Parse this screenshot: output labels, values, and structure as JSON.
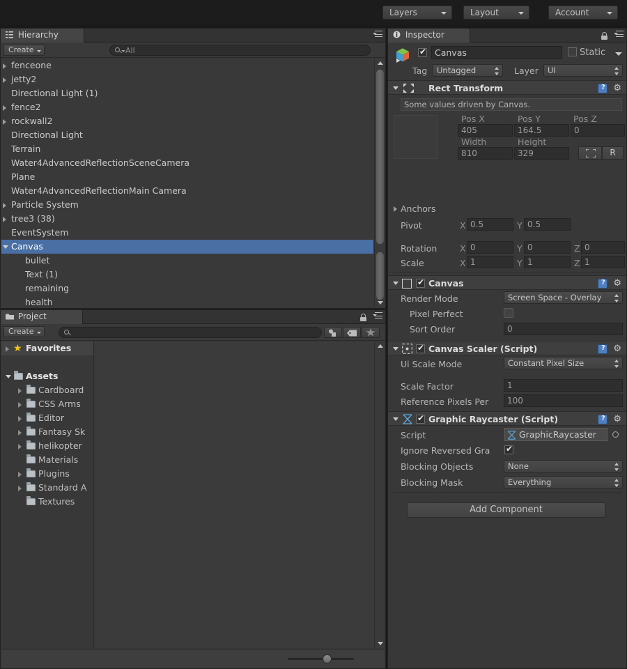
{
  "toolbar": {
    "buttons": [
      {
        "label": "Layers",
        "icon": "chevron-down-icon"
      },
      {
        "label": "Layout",
        "icon": "chevron-down-icon"
      },
      {
        "label": "Account",
        "icon": "chevron-down-icon"
      }
    ]
  },
  "hierarchy": {
    "tab_label": "Hierarchy",
    "tab_icon": "hierarchy-icon",
    "menu_icon": "panel-menu-icon",
    "create_label": "Create",
    "search_value": "All",
    "search_icon": "search-icon",
    "items": [
      {
        "label": "fenceone",
        "depth": 0,
        "arrow": "collapsed",
        "selected": false
      },
      {
        "label": "jetty2",
        "depth": 0,
        "arrow": "collapsed",
        "selected": false
      },
      {
        "label": "Directional Light (1)",
        "depth": 0,
        "arrow": "none",
        "selected": false
      },
      {
        "label": "fence2",
        "depth": 0,
        "arrow": "collapsed",
        "selected": false
      },
      {
        "label": "rockwall2",
        "depth": 0,
        "arrow": "collapsed",
        "selected": false
      },
      {
        "label": "Directional Light",
        "depth": 0,
        "arrow": "none",
        "selected": false
      },
      {
        "label": "Terrain",
        "depth": 0,
        "arrow": "none",
        "selected": false
      },
      {
        "label": "Water4AdvancedReflectionSceneCamera",
        "depth": 0,
        "arrow": "none",
        "selected": false
      },
      {
        "label": "Plane",
        "depth": 0,
        "arrow": "none",
        "selected": false
      },
      {
        "label": "Water4AdvancedReflectionMain Camera",
        "depth": 0,
        "arrow": "none",
        "selected": false
      },
      {
        "label": "Particle System",
        "depth": 0,
        "arrow": "collapsed",
        "selected": false
      },
      {
        "label": "tree3 (38)",
        "depth": 0,
        "arrow": "collapsed",
        "selected": false
      },
      {
        "label": "EventSystem",
        "depth": 0,
        "arrow": "none",
        "selected": false
      },
      {
        "label": "Canvas",
        "depth": 0,
        "arrow": "expanded",
        "selected": true
      },
      {
        "label": "bullet",
        "depth": 1,
        "arrow": "none",
        "selected": false
      },
      {
        "label": "Text (1)",
        "depth": 1,
        "arrow": "none",
        "selected": false
      },
      {
        "label": "remaining",
        "depth": 1,
        "arrow": "none",
        "selected": false
      },
      {
        "label": "health",
        "depth": 1,
        "arrow": "none",
        "selected": false
      }
    ]
  },
  "project": {
    "tab_label": "Project",
    "tab_icon": "folder-icon",
    "lock_icon": "lock-icon",
    "menu_icon": "panel-menu-icon",
    "create_label": "Create",
    "search_value": "",
    "search_icon": "search-icon",
    "filter_icons": [
      "shapes-filter-icon",
      "label-filter-icon",
      "favorite-star-icon"
    ],
    "tree": [
      {
        "label": "Favorites",
        "depth": 0,
        "arrow": "collapsed",
        "icon": "star-icon",
        "bold": true,
        "highlight": true
      },
      {
        "label": "",
        "depth": 0,
        "arrow": "none",
        "icon": "none",
        "bold": false,
        "highlight": false
      },
      {
        "label": "Assets",
        "depth": 0,
        "arrow": "expanded",
        "icon": "folder-icon",
        "bold": true,
        "highlight": false
      },
      {
        "label": "Cardboard",
        "depth": 1,
        "arrow": "collapsed",
        "icon": "folder-icon",
        "bold": false,
        "highlight": false
      },
      {
        "label": "CSS Arms",
        "depth": 1,
        "arrow": "collapsed",
        "icon": "folder-icon",
        "bold": false,
        "highlight": false
      },
      {
        "label": "Editor",
        "depth": 1,
        "arrow": "collapsed",
        "icon": "folder-icon",
        "bold": false,
        "highlight": false
      },
      {
        "label": "Fantasy Sk",
        "depth": 1,
        "arrow": "collapsed",
        "icon": "folder-icon",
        "bold": false,
        "highlight": false
      },
      {
        "label": "helikopter",
        "depth": 1,
        "arrow": "collapsed",
        "icon": "folder-icon",
        "bold": false,
        "highlight": false
      },
      {
        "label": "Materials",
        "depth": 1,
        "arrow": "none",
        "icon": "folder-icon",
        "bold": false,
        "highlight": false
      },
      {
        "label": "Plugins",
        "depth": 1,
        "arrow": "collapsed",
        "icon": "folder-icon",
        "bold": false,
        "highlight": false
      },
      {
        "label": "Standard A",
        "depth": 1,
        "arrow": "collapsed",
        "icon": "folder-icon",
        "bold": false,
        "highlight": false
      },
      {
        "label": "Textures",
        "depth": 1,
        "arrow": "none",
        "icon": "folder-icon",
        "bold": false,
        "highlight": false
      }
    ],
    "zoom_slider_icon": "zoom-slider"
  },
  "inspector": {
    "tab_label": "Inspector",
    "tab_icon": "info-icon",
    "lock_icon": "lock-icon",
    "menu_icon": "panel-menu-icon",
    "gameobject": {
      "icon": "prefab-cube-icon",
      "enabled": true,
      "name": "Canvas",
      "static_label": "Static",
      "static_checked": false,
      "tag_label": "Tag",
      "tag_value": "Untagged",
      "layer_label": "Layer",
      "layer_value": "UI"
    },
    "rect_transform": {
      "title": "Rect Transform",
      "icon": "rect-transform-icon",
      "help_icon": "help-icon",
      "gear_icon": "gear-icon",
      "notice": "Some values driven by Canvas.",
      "pos_x_label": "Pos X",
      "pos_x": "405",
      "pos_y_label": "Pos Y",
      "pos_y": "164.5",
      "pos_z_label": "Pos Z",
      "pos_z": "0",
      "width_label": "Width",
      "width": "810",
      "height_label": "Height",
      "height": "329",
      "blueprint_button": "anchor-preset-icon",
      "raw_button": "R",
      "anchors_label": "Anchors",
      "pivot_label": "Pivot",
      "pivot_x_axis": "X",
      "pivot_x": "0.5",
      "pivot_y_axis": "Y",
      "pivot_y": "0.5",
      "rotation_label": "Rotation",
      "rot_x_axis": "X",
      "rot_x": "0",
      "rot_y_axis": "Y",
      "rot_y": "0",
      "rot_z_axis": "Z",
      "rot_z": "0",
      "scale_label": "Scale",
      "scale_x_axis": "X",
      "scale_x": "1",
      "scale_y_axis": "Y",
      "scale_y": "1",
      "scale_z_axis": "Z",
      "scale_z": "1"
    },
    "canvas": {
      "title": "Canvas",
      "icon": "canvas-icon",
      "enabled": true,
      "help_icon": "help-icon",
      "gear_icon": "gear-icon",
      "render_mode_label": "Render Mode",
      "render_mode_value": "Screen Space - Overlay",
      "pixel_perfect_label": "Pixel Perfect",
      "pixel_perfect_checked": false,
      "sort_order_label": "Sort Order",
      "sort_order_value": "0"
    },
    "canvas_scaler": {
      "title": "Canvas Scaler (Script)",
      "icon": "canvas-scaler-icon",
      "enabled": true,
      "help_icon": "help-icon",
      "gear_icon": "gear-icon",
      "ui_scale_mode_label": "Ui Scale Mode",
      "ui_scale_mode_value": "Constant Pixel Size",
      "scale_factor_label": "Scale Factor",
      "scale_factor_value": "1",
      "ref_pixels_label": "Reference Pixels Per",
      "ref_pixels_value": "100"
    },
    "graphic_raycaster": {
      "title": "Graphic Raycaster (Script)",
      "icon": "script-icon",
      "enabled": true,
      "help_icon": "help-icon",
      "gear_icon": "gear-icon",
      "script_label": "Script",
      "script_value": "GraphicRaycaster",
      "script_picker_icon": "object-picker-icon",
      "ignore_reversed_label": "Ignore Reversed Gra",
      "ignore_reversed_checked": true,
      "blocking_objects_label": "Blocking Objects",
      "blocking_objects_value": "None",
      "blocking_mask_label": "Blocking Mask",
      "blocking_mask_value": "Everything"
    },
    "add_component_label": "Add Component"
  },
  "colors": {
    "selection_blue": "#4a6fa5",
    "panel_bg": "#383838",
    "toolbar_bg": "#1c1c1c",
    "text": "#b7b7b7"
  }
}
